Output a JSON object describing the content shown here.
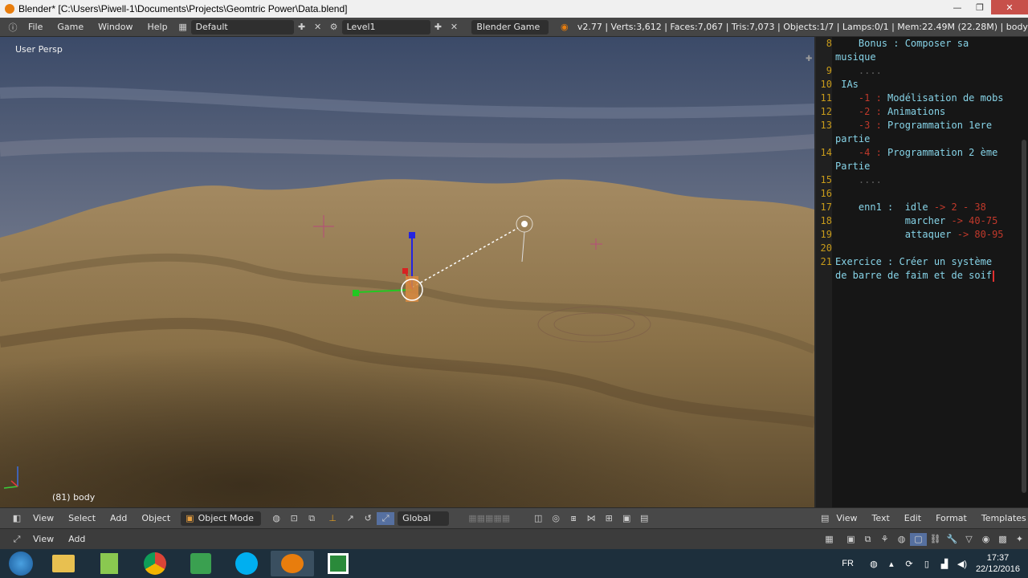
{
  "window": {
    "title": "Blender* [C:\\Users\\Piwell-1\\Documents\\Projects\\Geomtric Power\\Data.blend]",
    "minimize": "—",
    "maximize": "❐",
    "close": "✕"
  },
  "info_header": {
    "menus": [
      "File",
      "Game",
      "Window",
      "Help"
    ],
    "screen_layout": "Default",
    "scene": "Level1",
    "engine": "Blender Game",
    "stats": "v2.77 | Verts:3,612 | Faces:7,067 | Tris:7,073 | Objects:1/7 | Lamps:0/1 | Mem:22.49M (22.28M) | body"
  },
  "viewport": {
    "label": "User Persp",
    "object_label": "(81) body"
  },
  "viewport_header": {
    "menus": [
      "View",
      "Select",
      "Add",
      "Object"
    ],
    "mode": "Object Mode",
    "orientation": "Global"
  },
  "timeline_header": {
    "menus": [
      "View",
      "Add"
    ]
  },
  "text_editor": {
    "lines": [
      {
        "n": "8",
        "parts": [
          {
            "t": "    Bonus : Composer sa",
            "c": "code"
          }
        ]
      },
      {
        "n": "",
        "parts": [
          {
            "t": "musique",
            "c": "code"
          }
        ]
      },
      {
        "n": "9",
        "parts": [
          {
            "t": "    ....",
            "c": "dim"
          }
        ]
      },
      {
        "n": "10",
        "parts": [
          {
            "t": " IAs",
            "c": "code"
          }
        ]
      },
      {
        "n": "11",
        "parts": [
          {
            "t": "    -1 : ",
            "c": "num"
          },
          {
            "t": "Modélisation de mobs",
            "c": "code"
          }
        ]
      },
      {
        "n": "12",
        "parts": [
          {
            "t": "    -2 : ",
            "c": "num"
          },
          {
            "t": "Animations",
            "c": "code"
          }
        ]
      },
      {
        "n": "13",
        "parts": [
          {
            "t": "    -3 : ",
            "c": "num"
          },
          {
            "t": "Programmation 1ere",
            "c": "code"
          }
        ]
      },
      {
        "n": "",
        "parts": [
          {
            "t": "partie",
            "c": "code"
          }
        ]
      },
      {
        "n": "14",
        "parts": [
          {
            "t": "    -4 : ",
            "c": "num"
          },
          {
            "t": "Programmation 2 ème",
            "c": "code"
          }
        ]
      },
      {
        "n": "",
        "parts": [
          {
            "t": "Partie",
            "c": "code"
          }
        ]
      },
      {
        "n": "15",
        "parts": [
          {
            "t": "    ....",
            "c": "dim"
          }
        ]
      },
      {
        "n": "16",
        "parts": []
      },
      {
        "n": "17",
        "parts": [
          {
            "t": "    enn1 :  idle ",
            "c": "code"
          },
          {
            "t": "-> 2 - 38",
            "c": "num"
          }
        ]
      },
      {
        "n": "18",
        "parts": [
          {
            "t": "            marcher ",
            "c": "code"
          },
          {
            "t": "-> 40-75",
            "c": "num"
          }
        ]
      },
      {
        "n": "19",
        "parts": [
          {
            "t": "            attaquer ",
            "c": "code"
          },
          {
            "t": "-> 80-95",
            "c": "num"
          }
        ]
      },
      {
        "n": "20",
        "parts": []
      },
      {
        "n": "21",
        "parts": [
          {
            "t": "Exercice : Créer un système",
            "c": "code"
          }
        ]
      },
      {
        "n": "",
        "parts": [
          {
            "t": "de barre de faim et de soif",
            "c": "code"
          }
        ]
      }
    ]
  },
  "text_editor_header": {
    "menus": [
      "View",
      "Text",
      "Edit",
      "Format",
      "Templates"
    ]
  },
  "taskbar": {
    "apps": [
      "start-orb",
      "file-explorer",
      "notepad",
      "chrome",
      "hp-app",
      "skype",
      "blender",
      "camtasia"
    ],
    "language": "FR",
    "time": "17:37",
    "date": "22/12/2016"
  },
  "colors": {
    "accent": "#e87d0d",
    "editor_text": "#87d4e8",
    "editor_number": "#c0392b",
    "line_numbers": "#c89b1a"
  }
}
